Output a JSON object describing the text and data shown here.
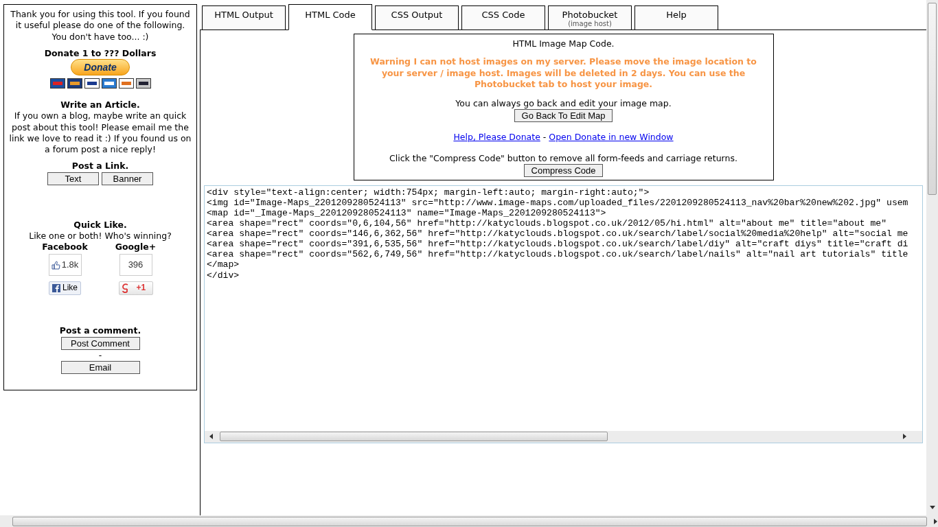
{
  "sidebar": {
    "intro": "Thank you for using this tool. If you found it useful please do one of the following. You don't have too... :)",
    "donate": {
      "heading": "Donate 1 to ??? Dollars",
      "button": "Donate"
    },
    "article": {
      "heading": "Write an Article.",
      "text": "If you own a blog, maybe write an quick post about this tool! Please email me the link we love to read it :) If you found us on a forum post a nice reply!"
    },
    "post_link": {
      "heading": "Post a Link.",
      "buttons": [
        "Text",
        "Banner"
      ]
    },
    "quick_like": {
      "heading": "Quick Like.",
      "text": "Like one or both! Who's winning?",
      "networks": [
        {
          "kind": "facebook",
          "label": "Facebook",
          "count": "1.8k",
          "button": "Like"
        },
        {
          "kind": "google",
          "label": "Google+",
          "count": "396",
          "button": "+1"
        }
      ]
    },
    "comment": {
      "heading": "Post a comment.",
      "buttons": [
        "Post Comment",
        "Email"
      ],
      "separator": "-"
    }
  },
  "tabs": [
    {
      "label": "HTML Output",
      "selected": false
    },
    {
      "label": "HTML Code",
      "selected": true
    },
    {
      "label": "CSS Output",
      "selected": false
    },
    {
      "label": "CSS Code",
      "selected": false
    },
    {
      "label": "Photobucket",
      "sublabel": "(image host)",
      "selected": false
    },
    {
      "label": "Help",
      "selected": false
    }
  ],
  "panel": {
    "title": "HTML Image Map Code.",
    "warning": "Warning I can not host images on my server. Please move the image location to your server / image host. Images will be deleted in 2 days. You can use the Photobucket tab to host your image.",
    "edit_note": "You can always go back and edit your image map.",
    "edit_button": "Go Back To Edit Map",
    "links": [
      "Help, Please Donate",
      "Open Donate in new Window"
    ],
    "link_separator": "-",
    "compress_note": "Click the \"Compress Code\" button to remove all form-feeds and carriage returns.",
    "compress_button": "Compress Code"
  },
  "code": {
    "lines": [
      "<div style=\"text-align:center; width:754px; margin-left:auto; margin-right:auto;\">",
      "<img id=\"Image-Maps_2201209280524113\" src=\"http://www.image-maps.com/uploaded_files/2201209280524113_nav%20bar%20new%202.jpg\" usem",
      "<map id=\"_Image-Maps_2201209280524113\" name=\"Image-Maps_2201209280524113\">",
      "<area shape=\"rect\" coords=\"0,6,104,56\" href=\"http://katyclouds.blogspot.co.uk/2012/05/hi.html\" alt=\"about me\" title=\"about me\"",
      "<area shape=\"rect\" coords=\"146,6,362,56\" href=\"http://katyclouds.blogspot.co.uk/search/label/social%20media%20help\" alt=\"social me",
      "<area shape=\"rect\" coords=\"391,6,535,56\" href=\"http://katyclouds.blogspot.co.uk/search/label/diy\" alt=\"craft diys\" title=\"craft di",
      "<area shape=\"rect\" coords=\"562,6,749,56\" href=\"http://katyclouds.blogspot.co.uk/search/label/nails\" alt=\"nail art tutorials\" title",
      "</map>",
      "</div>"
    ]
  }
}
